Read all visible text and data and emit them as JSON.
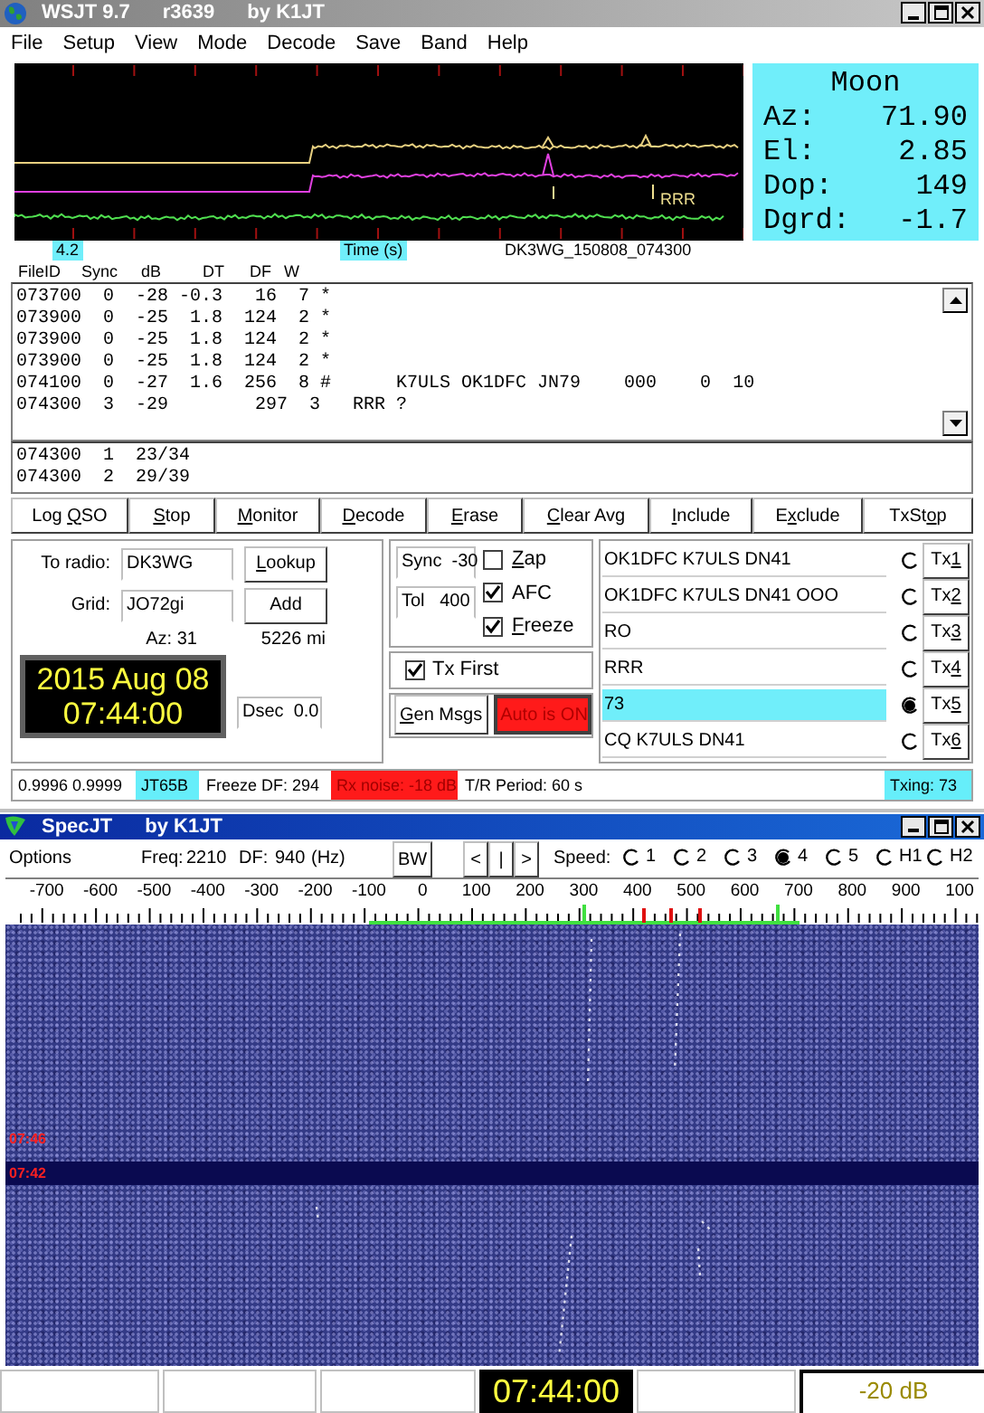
{
  "main_window": {
    "title": "WSJT 9.7",
    "version": "r3639",
    "author": "by K1JT"
  },
  "menu": [
    "File",
    "Setup",
    "View",
    "Mode",
    "Decode",
    "Save",
    "Band",
    "Help"
  ],
  "plot": {
    "marker_label": "RRR",
    "x_value": "4.2",
    "x_label": "Time (s)",
    "file_name": "DK3WG_150808_074300"
  },
  "moon": {
    "title": "Moon",
    "rows": [
      {
        "label": "Az:",
        "value": "71.90"
      },
      {
        "label": "El:",
        "value": "2.85"
      },
      {
        "label": "Dop:",
        "value": "149"
      },
      {
        "label": "Dgrd:",
        "value": "-1.7"
      }
    ]
  },
  "decode_columns": [
    "FileID",
    "Sync",
    "dB",
    "DT",
    "DF",
    "W"
  ],
  "decoded_lines": [
    "073700  0  -28 -0.3   16  7 *",
    "073900  0  -25  1.8  124  2 *",
    "073900  0  -25  1.8  124  2 *",
    "073900  0  -25  1.8  124  2 *",
    "074100  0  -27  1.6  256  8 #      K7ULS OK1DFC JN79    000    0  10",
    "074300  3  -29        297  3   RRR ?"
  ],
  "average_lines": [
    "074300  1  23/34",
    "074300  2  29/39"
  ],
  "buttons": [
    {
      "before": "Log ",
      "key": "Q",
      "after": "SO"
    },
    {
      "key": "S",
      "after": "top"
    },
    {
      "key": "M",
      "after": "onitor"
    },
    {
      "key": "D",
      "after": "ecode"
    },
    {
      "key": "E",
      "after": "rase"
    },
    {
      "key": "C",
      "after": "lear Avg"
    },
    {
      "key": "I",
      "after": "nclude"
    },
    {
      "before": "E",
      "key": "x",
      "after": "clude"
    },
    {
      "before": "TxSt",
      "key": "o",
      "after": "p"
    }
  ],
  "station": {
    "to_radio_label": "To radio:",
    "to_radio": "DK3WG",
    "grid_label": "Grid:",
    "grid": "JO72gi",
    "lookup": {
      "key": "L",
      "after": "ookup"
    },
    "add": {
      "text": "Add"
    },
    "azimuth": "Az: 31",
    "distance": "5226 mi",
    "date": "2015 Aug 08",
    "time": "07:44:00",
    "dsec": "Dsec  0.0"
  },
  "middle": {
    "sync": "Sync  -30",
    "tol": "Tol   400",
    "checkboxes": [
      {
        "key": "Z",
        "after": "ap",
        "checked": false
      },
      {
        "text": "AFC",
        "checked": true
      },
      {
        "key": "F",
        "after": "reeze",
        "checked": true
      }
    ],
    "tx_first": {
      "text": "Tx First",
      "checked": true
    },
    "gen_msgs": {
      "key": "G",
      "after": "en Msgs"
    },
    "auto": {
      "text": "Auto is  ON",
      "on": true
    }
  },
  "messages": [
    {
      "text": "OK1DFC K7ULS DN41",
      "selected": false,
      "tx": {
        "before": "Tx",
        "key": "1"
      }
    },
    {
      "text": "OK1DFC K7ULS DN41 OOO",
      "selected": false,
      "tx": {
        "before": "Tx",
        "key": "2"
      }
    },
    {
      "text": "RO",
      "selected": false,
      "tx": {
        "before": "Tx",
        "key": "3"
      }
    },
    {
      "text": "RRR",
      "selected": false,
      "tx": {
        "before": "Tx",
        "key": "4"
      }
    },
    {
      "text": "73",
      "selected": true,
      "tx": {
        "before": "Tx",
        "key": "5"
      }
    },
    {
      "text": "CQ K7ULS DN41",
      "selected": false,
      "tx": {
        "before": "Tx",
        "key": "6"
      }
    }
  ],
  "status": [
    {
      "text": "0.9996 0.9999",
      "color": "#ffffff"
    },
    {
      "text": "JT65B",
      "color": "#66eefa"
    },
    {
      "text": "Freeze DF: 294",
      "color": "#ffffff"
    },
    {
      "text": "Rx noise: -18 dB",
      "color": "#ff1a1a"
    },
    {
      "text": "T/R Period: 60 s",
      "color": "#ffffff"
    },
    {
      "text": "Txing: 73",
      "color": "#66eefa"
    }
  ],
  "spec": {
    "title": "SpecJT",
    "author": "by K1JT",
    "options": "Options",
    "freq_label": "Freq:",
    "freq": "2210",
    "df_label": "DF:",
    "df": "940",
    "unit": "(Hz)",
    "bw": "BW",
    "nav": [
      "<",
      "|",
      ">"
    ],
    "speed_label": "Speed:",
    "speeds": [
      {
        "label": "1",
        "selected": false
      },
      {
        "label": "2",
        "selected": false
      },
      {
        "label": "3",
        "selected": false
      },
      {
        "label": "4",
        "selected": true
      },
      {
        "label": "5",
        "selected": false
      },
      {
        "label": "H1",
        "selected": false
      },
      {
        "label": "H2",
        "selected": false
      }
    ],
    "scale_labels": [
      "-700",
      "-600",
      "-500",
      "-400",
      "-300",
      "-200",
      "-100",
      "0",
      "100",
      "200",
      "300",
      "400",
      "500",
      "600",
      "700",
      "800",
      "900",
      "100"
    ],
    "time_marks": [
      "07:46",
      "07:42"
    ],
    "clock": "07:44:00",
    "level_reading": "-20 dB"
  }
}
